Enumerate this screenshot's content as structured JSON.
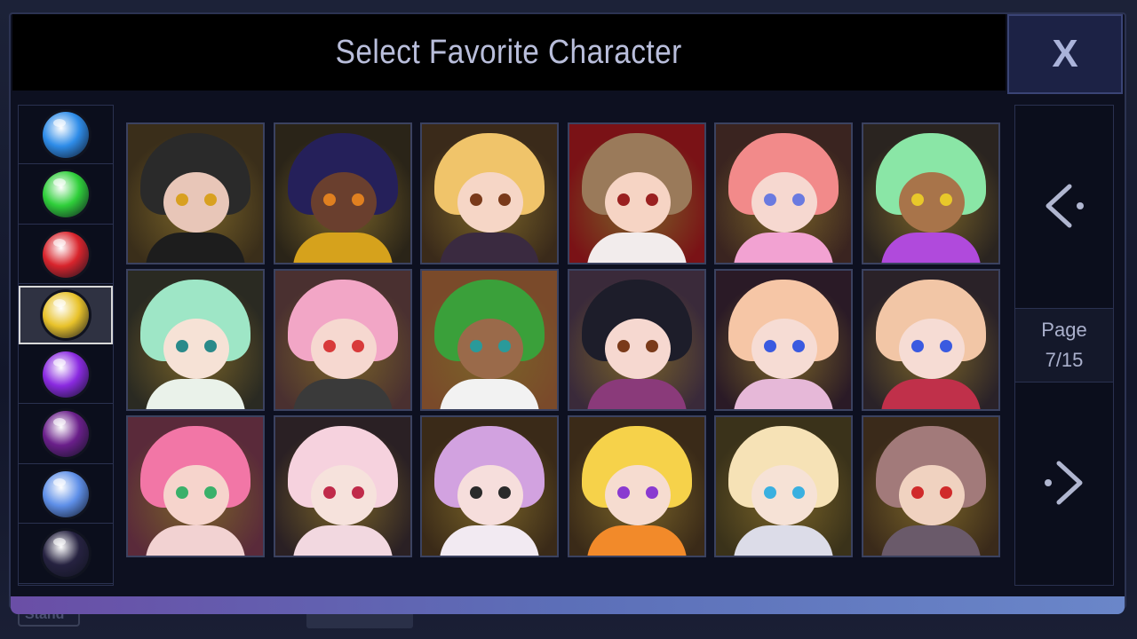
{
  "dialog": {
    "title": "Select Favorite Character",
    "close_label": "X"
  },
  "background": {
    "ghost_button_label": "Stand"
  },
  "elements": [
    {
      "name": "water",
      "color": "#2e8ce8",
      "icon": "water-drop-icon"
    },
    {
      "name": "nature",
      "color": "#2fcf3a",
      "icon": "leaf-icon"
    },
    {
      "name": "fire",
      "color": "#d8242c",
      "icon": "flame-icon"
    },
    {
      "name": "light",
      "color": "#e8c22a",
      "icon": "sun-icon"
    },
    {
      "name": "void",
      "color": "#8a2ae0",
      "icon": "crescent-icon"
    },
    {
      "name": "dark",
      "color": "#6a1f8a",
      "icon": "star-sigil-icon"
    },
    {
      "name": "air",
      "color": "#5e8fe8",
      "icon": "swirl-icon"
    },
    {
      "name": "shadow",
      "color": "#262240",
      "icon": "eye-sigil-icon"
    }
  ],
  "selected_element_index": 3,
  "characters": [
    {
      "hair": "#2a2a2a",
      "skin": "#e8c6b8",
      "eyes": "#d8a020",
      "body": "#1d1d1d",
      "bg": "#3a2e1a"
    },
    {
      "hair": "#25205a",
      "skin": "#6a3f2e",
      "eyes": "#e08020",
      "body": "#d6a21c",
      "bg": "#2a2418"
    },
    {
      "hair": "#f0c46a",
      "skin": "#f6d6c6",
      "eyes": "#7a3a1a",
      "body": "#3a2a40",
      "bg": "#3a2a1a"
    },
    {
      "hair": "#9a7a5a",
      "skin": "#f6d4c4",
      "eyes": "#9a2020",
      "body": "#f2ecec",
      "bg": "#7a1216"
    },
    {
      "hair": "#f28a8a",
      "skin": "#f6d8d0",
      "eyes": "#6a7ae0",
      "body": "#f2a2d2",
      "bg": "#3a2420"
    },
    {
      "hair": "#8ae6a6",
      "skin": "#a8744a",
      "eyes": "#e8c82a",
      "body": "#b04adc",
      "bg": "#2a2420"
    },
    {
      "hair": "#9ee6c6",
      "skin": "#f6e2d6",
      "eyes": "#2a8a8a",
      "body": "#eaf2ea",
      "bg": "#2a2a22"
    },
    {
      "hair": "#f2a6c6",
      "skin": "#f6d8d0",
      "eyes": "#d83a3a",
      "body": "#3a3a3a",
      "bg": "#4a3030"
    },
    {
      "hair": "#3aa03a",
      "skin": "#9a6a4a",
      "eyes": "#2a9a9a",
      "body": "#f2f2f2",
      "bg": "#7a4a2a"
    },
    {
      "hair": "#1d1d2a",
      "skin": "#f6d8d0",
      "eyes": "#7a3a1a",
      "body": "#8a3a7a",
      "bg": "#3a2a3a"
    },
    {
      "hair": "#f6c6a6",
      "skin": "#f6dcd4",
      "eyes": "#3a5ae0",
      "body": "#e6b8d8",
      "bg": "#2a1a26"
    },
    {
      "hair": "#f2c6a6",
      "skin": "#f6dcd4",
      "eyes": "#3a5ae0",
      "body": "#c0304a",
      "bg": "#2a2228"
    },
    {
      "hair": "#f276a6",
      "skin": "#f6d4cc",
      "eyes": "#3ab06a",
      "body": "#f2d2d2",
      "bg": "#5a2a3a"
    },
    {
      "hair": "#f6d2de",
      "skin": "#f6e2dc",
      "eyes": "#c02a4a",
      "body": "#f2d8e0",
      "bg": "#2a2024"
    },
    {
      "hair": "#d2a2e0",
      "skin": "#f6dedc",
      "eyes": "#2a2a2a",
      "body": "#f2eaf2",
      "bg": "#3a2a18"
    },
    {
      "hair": "#f6d24a",
      "skin": "#f6dcd0",
      "eyes": "#8a3ad0",
      "body": "#f28a2a",
      "bg": "#3a2a18"
    },
    {
      "hair": "#f6e2b6",
      "skin": "#f6e2d6",
      "eyes": "#3ab0e0",
      "body": "#dcdce8",
      "bg": "#3a321a"
    },
    {
      "hair": "#a27a7a",
      "skin": "#f0d2c0",
      "eyes": "#d02a2a",
      "body": "#6a5a6a",
      "bg": "#3a2a1a"
    }
  ],
  "pagination": {
    "label": "Page",
    "indicator": "7/15",
    "prev_icon": "chevron-left-icon",
    "next_icon": "chevron-right-icon"
  }
}
